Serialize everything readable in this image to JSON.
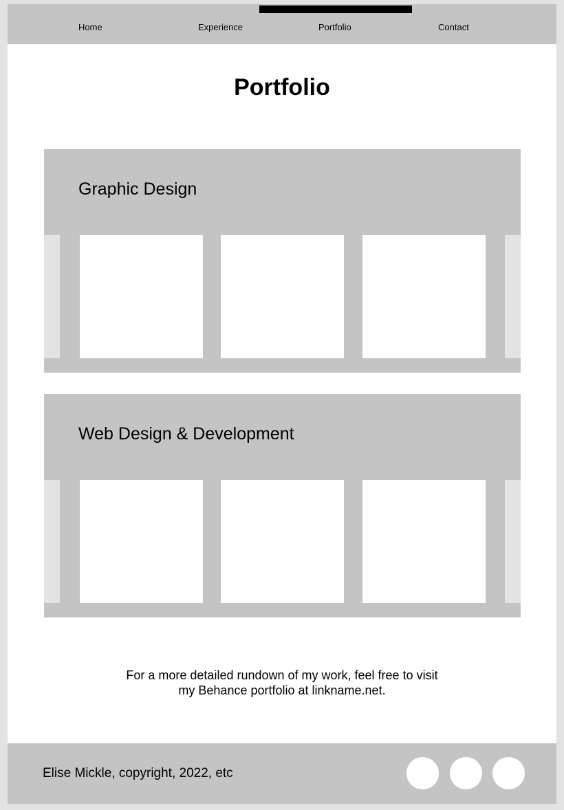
{
  "nav": {
    "items": [
      {
        "label": "Home"
      },
      {
        "label": "Experience"
      },
      {
        "label": "Portfolio"
      },
      {
        "label": "Contact"
      }
    ],
    "active": "Portfolio"
  },
  "page_title": "Portfolio",
  "sections": [
    {
      "title": "Graphic Design"
    },
    {
      "title": "Web Design & Development"
    }
  ],
  "blurb": "For a more detailed rundown of my work, feel free to visit my Behance portfolio at linkname.net.",
  "footer": {
    "copyright": "Elise Mickle, copyright, 2022, etc"
  },
  "colors": {
    "background": "#e3e3e3",
    "panel": "#c4c4c4",
    "surface": "#ffffff",
    "accent": "#000000"
  }
}
